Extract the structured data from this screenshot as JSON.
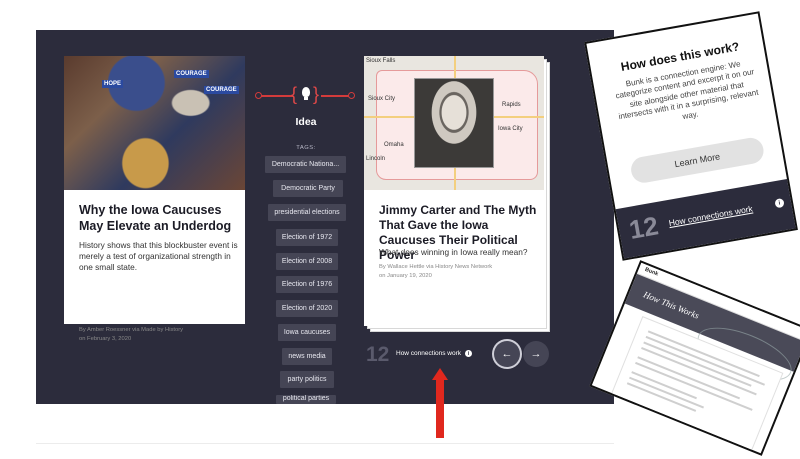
{
  "left_card": {
    "title": "Why the Iowa Caucuses May Elevate an Underdog",
    "description": "History shows that this blockbuster event is merely a test of organizational strength in one small state.",
    "byline": "By Amber Roessner via Made by History",
    "date": "on February 3, 2020",
    "photo_signs": [
      "HOPE",
      "COURAGE",
      "COURAGE"
    ]
  },
  "idea": {
    "label": "Idea",
    "tags_label": "TAGS:",
    "tags": [
      "Democratic Nationa...",
      "Democratic Party",
      "presidential elections",
      "Election of 1972",
      "Election of 2008",
      "Election of 1976",
      "Election of 2020",
      "Iowa caucuses",
      "news media",
      "party politics",
      "political parties"
    ]
  },
  "right_card": {
    "title": "Jimmy Carter and The Myth That Gave the Iowa Caucuses Their Political Power",
    "description": "What does winning in Iowa really mean?",
    "byline": "By Wallace Hettle via History News Network",
    "date": "on January 19, 2020",
    "map_labels": [
      "Sioux Falls",
      "Sioux City",
      "Omaha",
      "Lincoln",
      "Rapids",
      "Iowa City"
    ]
  },
  "connections": {
    "count": "12",
    "link_label": "How connections work",
    "info_glyph": "i",
    "prev_glyph": "←",
    "next_glyph": "→"
  },
  "popup_how": {
    "title": "How does this work?",
    "body": "Bunk is a connection engine: We categorize content and excerpt it on our site alongside other material that intersects with it in a surprising, relevant way.",
    "button": "Learn More",
    "count": "12",
    "link_label": "How connections work",
    "info_glyph": "i"
  },
  "popup_page": {
    "brand": "Bunk",
    "title": "How This Works"
  },
  "colors": {
    "panel": "#2c2c3c",
    "accent_red": "#e0281e",
    "tag_bg": "#454555"
  }
}
